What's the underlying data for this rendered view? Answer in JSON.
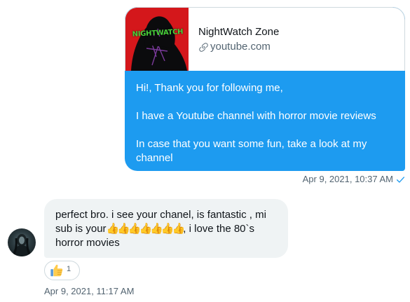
{
  "outgoing_message": {
    "link_card": {
      "thumbnail_text": "NIGHTWATCH",
      "title": "NightWatch Zone",
      "domain": "youtube.com",
      "link_icon": "link-icon"
    },
    "paragraphs": [
      "Hi!, Thank you for following me,",
      "I have a Youtube channel with horror movie reviews",
      "In case that you want some fun, take a look at my channel"
    ],
    "timestamp": "Apr 9, 2021, 10:37 AM",
    "status_icon": "check-icon",
    "bubble_color": "#1d9bf0"
  },
  "incoming_message": {
    "avatar_icon": "avatar",
    "text_part1": "perfect bro. i see your chanel, is fantastic , mi sub is your",
    "emoji_sequence": "👍👍👍👍👍👍👍",
    "text_part2": ", i love the 80`s horror movies",
    "reaction": {
      "emoji": "thumbs-up-icon",
      "count": "1"
    },
    "timestamp": "Apr 9, 2021, 11:17 AM",
    "bubble_color": "#eff3f4"
  }
}
